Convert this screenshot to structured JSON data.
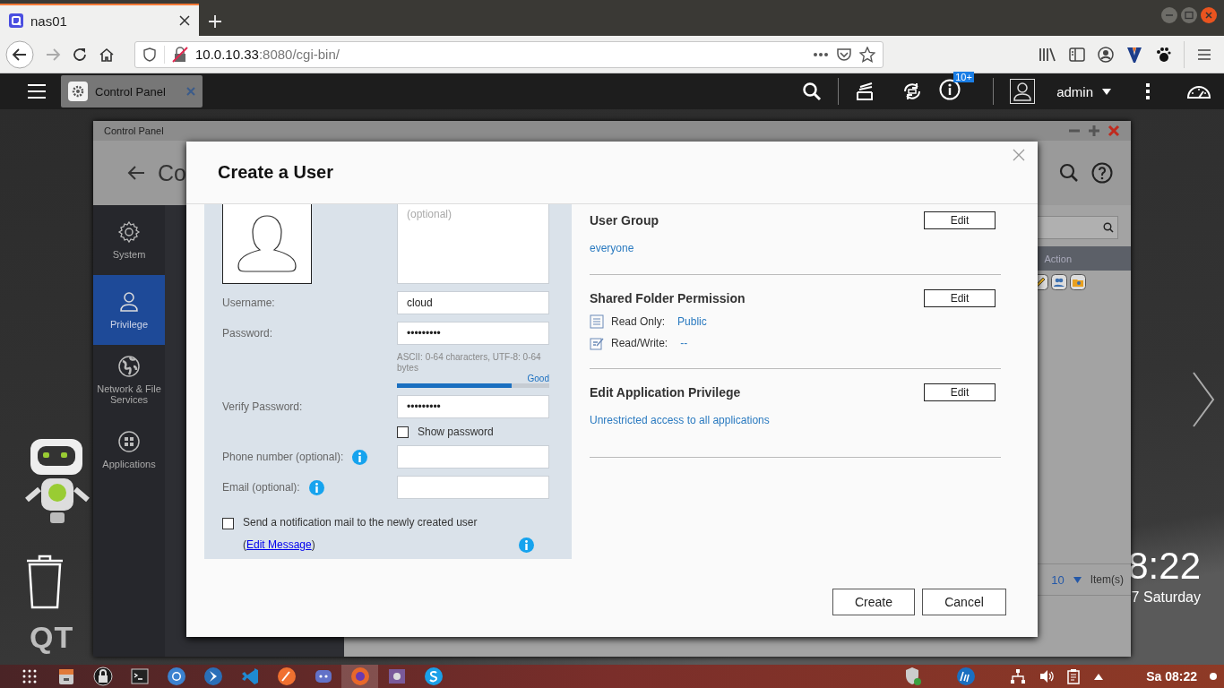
{
  "browser": {
    "tab_title": "nas01",
    "url_host": "10.0.10.33",
    "url_rest": ":8080/cgi-bin/"
  },
  "qts_bar": {
    "app_tab": "Control Panel",
    "badge": "10+",
    "user": "admin"
  },
  "desktop": {
    "logo": "QT",
    "clock": "8:22",
    "date": "7 Saturday"
  },
  "control_panel": {
    "title": "Control Panel",
    "heading": "Co",
    "sidebar": [
      {
        "label": "System",
        "selected": false
      },
      {
        "label": "Privilege",
        "selected": true
      },
      {
        "label": "Network & File Services",
        "selected": false
      },
      {
        "label": "Applications",
        "selected": false
      }
    ],
    "table_header": "Action",
    "page_size": "10",
    "pager_label": "Item(s)"
  },
  "dialog": {
    "title": "Create a User",
    "description_placeholder": "(optional)",
    "form": [
      {
        "kind": "input",
        "label": "Username:",
        "value": "cloud",
        "info": false
      },
      {
        "kind": "input",
        "label": "Password:",
        "value": "•••••••••",
        "info": false
      },
      {
        "kind": "hint",
        "text": "ASCII: 0-64 characters, UTF-8: 0-64 bytes"
      },
      {
        "kind": "meter",
        "reading": "Good",
        "level": 0.75
      },
      {
        "kind": "input",
        "label": "Verify Password:",
        "value": "•••••••••",
        "info": false
      },
      {
        "kind": "checkbox",
        "label": "Show password",
        "checked": false
      },
      {
        "kind": "input",
        "label": "Phone number (optional):",
        "info": true
      },
      {
        "kind": "input",
        "label": "Email (optional):",
        "info": true
      }
    ],
    "notification": {
      "checked": false,
      "text": "Send a notification mail to the newly created user (",
      "link": "Edit Message",
      "after": ")"
    },
    "sections": [
      {
        "kind": "text",
        "title": "User Group",
        "button": "Edit",
        "value": "everyone"
      },
      {
        "kind": "permissions",
        "title": "Shared Folder Permission",
        "button": "Edit",
        "rows": [
          {
            "label": "Read Only:",
            "value": "Public"
          },
          {
            "label": "Read/Write:",
            "value": "--"
          }
        ]
      },
      {
        "kind": "text",
        "title": "Edit Application Privilege",
        "button": "Edit",
        "value": "Unrestricted access to all applications"
      }
    ],
    "buttons": [
      "Create",
      "Cancel"
    ]
  },
  "taskbar": {
    "clock": "Sa 08:22"
  }
}
